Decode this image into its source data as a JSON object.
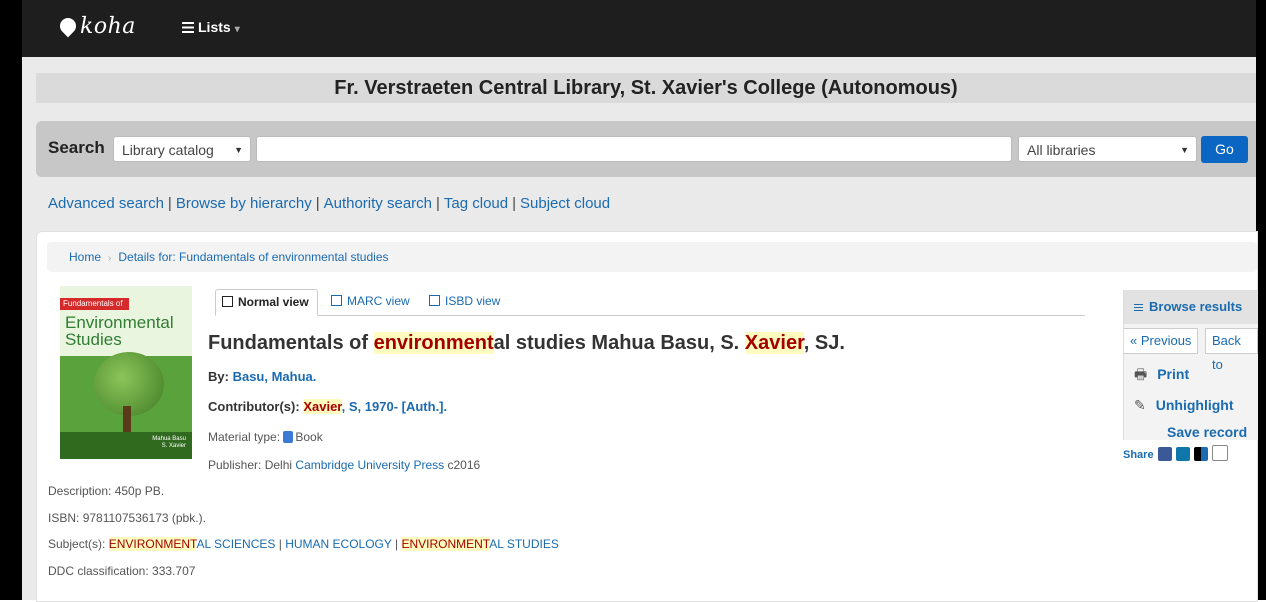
{
  "nav": {
    "logo": "koha",
    "lists_label": "Lists"
  },
  "header": {
    "library_name": "Fr. Verstraeten Central Library, St. Xavier's College (Autonomous)"
  },
  "search": {
    "label": "Search",
    "scope": "Library catalog",
    "query": "",
    "library": "All libraries",
    "go_label": "Go"
  },
  "more_searches": [
    "Advanced search",
    "Browse by hierarchy",
    "Authority search",
    "Tag cloud",
    "Subject cloud"
  ],
  "breadcrumb": {
    "home": "Home",
    "current": "Details for: Fundamentals of environmental studies"
  },
  "tabs": [
    "Normal view",
    "MARC view",
    "ISBD view"
  ],
  "record": {
    "title_parts": [
      "Fundamentals of ",
      "environment",
      "al studies Mahua Basu, S. ",
      "Xavier",
      ", SJ."
    ],
    "by_label": "By:",
    "author": "Basu, Mahua.",
    "contrib_label": "Contributor(s):",
    "contrib_hl": "Xavier",
    "contrib_rest": ", S, 1970- [Auth.].",
    "material_label": "Material type:",
    "material": "Book",
    "publisher_label": "Publisher:",
    "publisher_place": "Delhi",
    "publisher_name": "Cambridge University Press",
    "publisher_year": "c2016",
    "description_label": "Description:",
    "description": "450p PB.",
    "isbn_label": "ISBN:",
    "isbn": "9781107536173 (pbk.).",
    "subjects_label": "Subject(s):",
    "subject1_hl": "ENVIRONMENT",
    "subject1_rest": "AL SCIENCES",
    "subject2": "HUMAN ECOLOGY",
    "subject3_hl": "ENVIRONMENT",
    "subject3_rest": "AL STUDIES",
    "ddc_label": "DDC classification:",
    "ddc": "333.707"
  },
  "cover": {
    "tag": "Fundamentals of",
    "title_line1": "Environmental",
    "title_line2": "Studies",
    "authors": "Mahua Basu\nS. Xavier"
  },
  "sidebar": {
    "browse": "Browse results",
    "previous": "« Previous",
    "back": "Back to",
    "print": "Print",
    "unhighlight": "Unhighlight",
    "save": "Save record",
    "share": "Share"
  },
  "colors": {
    "accent": "#1a6bb0",
    "go": "#0a66c2",
    "highlight_bg": "#fffcc0",
    "highlight_fg": "#a50000"
  }
}
